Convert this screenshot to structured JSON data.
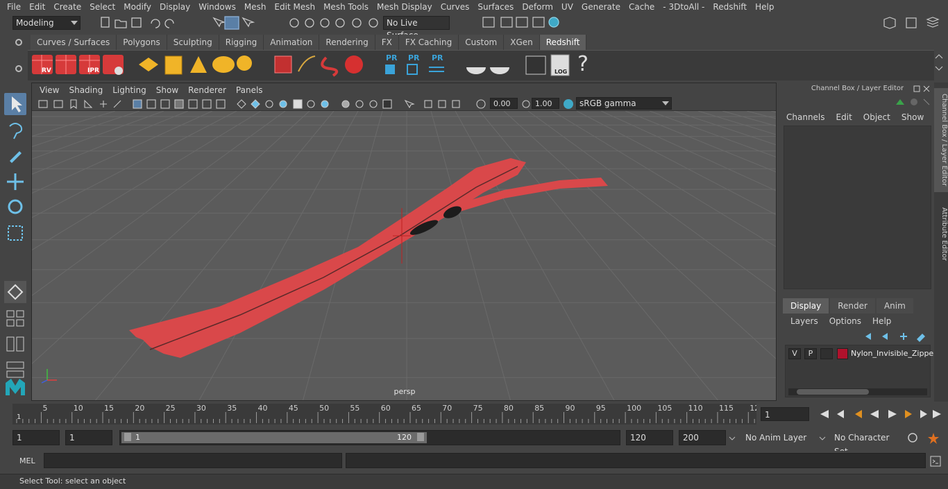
{
  "menubar": [
    "File",
    "Edit",
    "Create",
    "Select",
    "Modify",
    "Display",
    "Windows",
    "Mesh",
    "Edit Mesh",
    "Mesh Tools",
    "Mesh Display",
    "Curves",
    "Surfaces",
    "Deform",
    "UV",
    "Generate",
    "Cache",
    "- 3DtoAll -",
    "Redshift",
    "Help"
  ],
  "statusline": {
    "mode": "Modeling",
    "live_surface": "No Live Surface"
  },
  "shelf_tabs": [
    "Curves / Surfaces",
    "Polygons",
    "Sculpting",
    "Rigging",
    "Animation",
    "Rendering",
    "FX",
    "FX Caching",
    "Custom",
    "XGen",
    "Redshift"
  ],
  "shelf_active": "Redshift",
  "shelf_labels": {
    "rv": "RV",
    "ipr": "IPR",
    "pr1": "PR",
    "pr2": "PR",
    "pr3": "PR",
    "log": "LOG",
    "help": "?"
  },
  "viewport": {
    "menu": [
      "View",
      "Shading",
      "Lighting",
      "Show",
      "Renderer",
      "Panels"
    ],
    "exposure": "0.00",
    "gamma": "1.00",
    "color_space": "sRGB gamma",
    "camera": "persp",
    "colors": {
      "zipper_tape": "#d9484a",
      "zipper_pull": "#1c1c1c",
      "grid": "#6a6a6a",
      "background": "#5b5b5b"
    }
  },
  "channelbox": {
    "title": "Channel Box / Layer Editor",
    "menu": [
      "Channels",
      "Edit",
      "Object",
      "Show"
    ],
    "layer_tabs": [
      "Display",
      "Render",
      "Anim"
    ],
    "layer_menu": [
      "Layers",
      "Options",
      "Help"
    ],
    "layer": {
      "v": "V",
      "p": "P",
      "name": "Nylon_Invisible_Zipper",
      "color": "#b0122c"
    }
  },
  "side_tabs": [
    "Channel Box / Layer Editor",
    "Attribute Editor"
  ],
  "timeline": {
    "ticks": [
      "5",
      "10",
      "15",
      "20",
      "25",
      "30",
      "35",
      "40",
      "45",
      "50",
      "55",
      "60",
      "65",
      "70",
      "75",
      "80",
      "85",
      "90",
      "95",
      "100",
      "105",
      "110",
      "115",
      "12"
    ],
    "start_marker": "1",
    "current_frame": "1"
  },
  "range": {
    "start": "1",
    "anim_start": "1",
    "slider_start": "1",
    "slider_end": "120",
    "end": "120",
    "anim_end": "200",
    "anim_layer": "No Anim Layer",
    "character_set": "No Character Set"
  },
  "mel": {
    "label": "MEL"
  },
  "helpline": "Select Tool: select an object"
}
